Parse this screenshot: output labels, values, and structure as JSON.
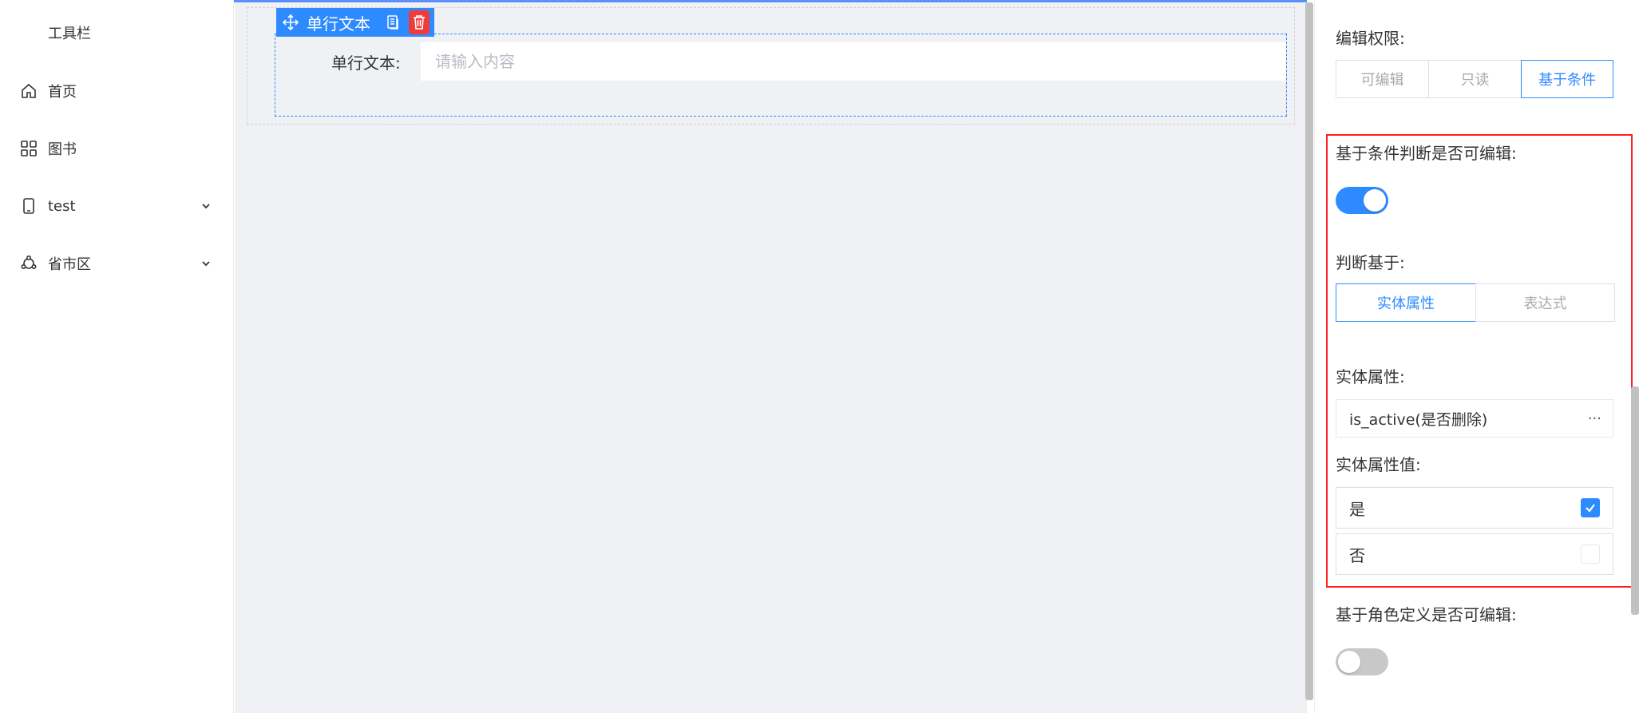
{
  "sidebar": {
    "title": "工具栏",
    "items": [
      {
        "label": "首页",
        "icon": "home-icon"
      },
      {
        "label": "图书",
        "icon": "grid-icon"
      },
      {
        "label": "test",
        "icon": "phone-icon",
        "expandable": true
      },
      {
        "label": "省市区",
        "icon": "cluster-icon",
        "expandable": true
      }
    ]
  },
  "canvas": {
    "toolbar": {
      "name": "单行文本",
      "icons": [
        "move-icon",
        "copy-icon",
        "delete-icon"
      ]
    },
    "field": {
      "label": "单行文本:",
      "placeholder": "请输入内容",
      "value": ""
    }
  },
  "panel": {
    "edit_permission": {
      "label": "编辑权限:",
      "options": [
        "可编辑",
        "只读",
        "基于条件"
      ],
      "selected": "基于条件"
    },
    "conditional_edit": {
      "label": "基于条件判断是否可编辑:",
      "enabled": true
    },
    "judge_basis": {
      "label": "判断基于:",
      "options": [
        "实体属性",
        "表达式"
      ],
      "selected": "实体属性"
    },
    "entity_attr": {
      "label": "实体属性:",
      "value": "is_active(是否删除)",
      "more": "···"
    },
    "entity_attr_value": {
      "label": "实体属性值:",
      "options": [
        {
          "label": "是",
          "checked": true
        },
        {
          "label": "否",
          "checked": false
        }
      ]
    },
    "role_edit": {
      "label": "基于角色定义是否可编辑:",
      "enabled": false
    }
  },
  "colors": {
    "accent": "#2e8bff",
    "danger": "#f03b3b",
    "highlight": "#ff1f1f",
    "canvas_bg": "#f0f1f4"
  }
}
